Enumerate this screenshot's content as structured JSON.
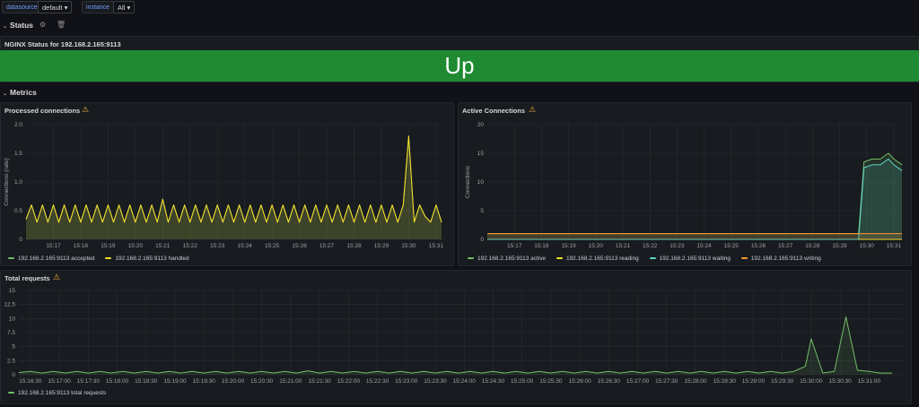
{
  "variables": {
    "datasource": {
      "label": "datasource",
      "value": "default"
    },
    "instance": {
      "label": "instance",
      "value": "All"
    }
  },
  "rows": {
    "status": {
      "title": "Status"
    },
    "metrics": {
      "title": "Metrics"
    }
  },
  "stat_panel": {
    "title": "NGINX Status for 192.168.2.165:9113",
    "value": "Up",
    "color": "#1f8a32"
  },
  "panels": {
    "processed": {
      "title": "Processed connections",
      "ylabel": "Connections (rate)",
      "legend": [
        "192.168.2.165:9113 accepted",
        "192.168.2.165:9113 handled"
      ]
    },
    "active": {
      "title": "Active Connections",
      "ylabel": "Connections",
      "legend": [
        "192.168.2.165:9113 active",
        "192.168.2.165:9113 reading",
        "192.168.2.165:9113 waiting",
        "192.168.2.165:9113 writing"
      ]
    },
    "total": {
      "title": "Total requests",
      "legend": [
        "192.168.2.165:9113 total requests"
      ]
    }
  },
  "colors": {
    "green": "#73bf69",
    "yellow": "#fade2a",
    "blue": "#8ab8ff",
    "orange": "#ff9830",
    "teal": "#5ed6c6",
    "warning": "#f5b73d"
  },
  "chart_data": [
    {
      "type": "line",
      "title": "Processed connections",
      "ylabel": "Connections (rate)",
      "ylim": [
        0,
        2.0
      ],
      "yticks": [
        "0",
        "0.5",
        "1.0",
        "1.5",
        "2.0"
      ],
      "xlim": [
        16.0,
        31.3
      ],
      "xticks": [
        "15:17",
        "15:18",
        "15:19",
        "15:20",
        "15:21",
        "15:22",
        "15:23",
        "15:24",
        "15:25",
        "15:26",
        "15:27",
        "15:28",
        "15:29",
        "15:30",
        "15:31"
      ],
      "xtick_minutes": [
        17,
        18,
        19,
        20,
        21,
        22,
        23,
        24,
        25,
        26,
        27,
        28,
        29,
        30,
        31
      ],
      "series": [
        {
          "name": "192.168.2.165:9113 accepted",
          "color": "#73bf69",
          "x": [
            16.0,
            16.2,
            16.4,
            16.6,
            16.8,
            17.0,
            17.2,
            17.4,
            17.6,
            17.8,
            18.0,
            18.2,
            18.4,
            18.6,
            18.8,
            19.0,
            19.2,
            19.4,
            19.6,
            19.8,
            20.0,
            20.2,
            20.4,
            20.6,
            20.8,
            21.0,
            21.2,
            21.4,
            21.6,
            21.8,
            22.0,
            22.2,
            22.4,
            22.6,
            22.8,
            23.0,
            23.2,
            23.4,
            23.6,
            23.8,
            24.0,
            24.2,
            24.4,
            24.6,
            24.8,
            25.0,
            25.2,
            25.4,
            25.6,
            25.8,
            26.0,
            26.2,
            26.4,
            26.6,
            26.8,
            27.0,
            27.2,
            27.4,
            27.6,
            27.8,
            28.0,
            28.2,
            28.4,
            28.6,
            28.8,
            29.0,
            29.2,
            29.4,
            29.6,
            29.8,
            30.0,
            30.2,
            30.4,
            30.6,
            30.8,
            31.0,
            31.2
          ],
          "y": [
            0.35,
            0.6,
            0.3,
            0.6,
            0.3,
            0.6,
            0.3,
            0.6,
            0.3,
            0.6,
            0.3,
            0.6,
            0.3,
            0.6,
            0.3,
            0.6,
            0.3,
            0.6,
            0.3,
            0.6,
            0.3,
            0.6,
            0.3,
            0.6,
            0.3,
            0.7,
            0.3,
            0.6,
            0.3,
            0.6,
            0.3,
            0.6,
            0.3,
            0.6,
            0.3,
            0.6,
            0.3,
            0.6,
            0.3,
            0.6,
            0.3,
            0.6,
            0.3,
            0.6,
            0.3,
            0.6,
            0.3,
            0.6,
            0.3,
            0.6,
            0.3,
            0.6,
            0.3,
            0.6,
            0.3,
            0.6,
            0.3,
            0.6,
            0.3,
            0.6,
            0.3,
            0.6,
            0.3,
            0.6,
            0.3,
            0.6,
            0.3,
            0.6,
            0.3,
            0.6,
            1.8,
            0.3,
            0.6,
            0.4,
            0.3,
            0.6,
            0.3
          ]
        },
        {
          "name": "192.168.2.165:9113 handled",
          "color": "#fade2a",
          "x": [
            16.0,
            16.2,
            16.4,
            16.6,
            16.8,
            17.0,
            17.2,
            17.4,
            17.6,
            17.8,
            18.0,
            18.2,
            18.4,
            18.6,
            18.8,
            19.0,
            19.2,
            19.4,
            19.6,
            19.8,
            20.0,
            20.2,
            20.4,
            20.6,
            20.8,
            21.0,
            21.2,
            21.4,
            21.6,
            21.8,
            22.0,
            22.2,
            22.4,
            22.6,
            22.8,
            23.0,
            23.2,
            23.4,
            23.6,
            23.8,
            24.0,
            24.2,
            24.4,
            24.6,
            24.8,
            25.0,
            25.2,
            25.4,
            25.6,
            25.8,
            26.0,
            26.2,
            26.4,
            26.6,
            26.8,
            27.0,
            27.2,
            27.4,
            27.6,
            27.8,
            28.0,
            28.2,
            28.4,
            28.6,
            28.8,
            29.0,
            29.2,
            29.4,
            29.6,
            29.8,
            30.0,
            30.2,
            30.4,
            30.6,
            30.8,
            31.0,
            31.2
          ],
          "y": [
            0.35,
            0.6,
            0.3,
            0.6,
            0.3,
            0.6,
            0.3,
            0.6,
            0.3,
            0.6,
            0.3,
            0.6,
            0.3,
            0.6,
            0.3,
            0.6,
            0.3,
            0.6,
            0.3,
            0.6,
            0.3,
            0.6,
            0.3,
            0.6,
            0.3,
            0.7,
            0.3,
            0.6,
            0.3,
            0.6,
            0.3,
            0.6,
            0.3,
            0.6,
            0.3,
            0.6,
            0.3,
            0.6,
            0.3,
            0.6,
            0.3,
            0.6,
            0.3,
            0.6,
            0.3,
            0.6,
            0.3,
            0.6,
            0.3,
            0.6,
            0.3,
            0.6,
            0.3,
            0.6,
            0.3,
            0.6,
            0.3,
            0.6,
            0.3,
            0.6,
            0.3,
            0.6,
            0.3,
            0.6,
            0.3,
            0.6,
            0.3,
            0.6,
            0.3,
            0.6,
            1.8,
            0.3,
            0.6,
            0.4,
            0.3,
            0.6,
            0.3
          ]
        }
      ]
    },
    {
      "type": "line",
      "title": "Active Connections",
      "ylabel": "Connections",
      "ylim": [
        0,
        20
      ],
      "yticks": [
        "0",
        "5",
        "10",
        "15",
        "20"
      ],
      "xlim": [
        16.0,
        31.3
      ],
      "xticks": [
        "15:17",
        "15:18",
        "15:19",
        "15:20",
        "15:21",
        "15:22",
        "15:23",
        "15:24",
        "15:25",
        "15:26",
        "15:27",
        "15:28",
        "15:29",
        "15:30",
        "15:31"
      ],
      "xtick_minutes": [
        17,
        18,
        19,
        20,
        21,
        22,
        23,
        24,
        25,
        26,
        27,
        28,
        29,
        30,
        31
      ],
      "series": [
        {
          "name": "192.168.2.165:9113 active",
          "color": "#73bf69",
          "x": [
            16.0,
            29.5,
            29.7,
            29.9,
            30.2,
            30.5,
            30.8,
            31.0,
            31.3
          ],
          "y": [
            1,
            1,
            1,
            13.5,
            14,
            14,
            15,
            14,
            13
          ]
        },
        {
          "name": "192.168.2.165:9113 reading",
          "color": "#fade2a",
          "x": [
            16.0,
            31.3
          ],
          "y": [
            0,
            0
          ]
        },
        {
          "name": "192.168.2.165:9113 waiting",
          "color": "#5ed6c6",
          "x": [
            16.0,
            29.5,
            29.7,
            29.9,
            30.2,
            30.5,
            30.8,
            31.0,
            31.3
          ],
          "y": [
            0,
            0,
            0,
            12.5,
            13,
            13,
            14,
            13,
            12
          ]
        },
        {
          "name": "192.168.2.165:9113 writing",
          "color": "#ff9830",
          "x": [
            16.0,
            31.3
          ],
          "y": [
            1,
            1
          ]
        }
      ]
    },
    {
      "type": "line",
      "title": "Total requests",
      "ylim": [
        0,
        15
      ],
      "yticks": [
        "0",
        "2.5",
        "5",
        "7.5",
        "10",
        "12.5",
        "15"
      ],
      "xlim": [
        16.3,
        31.6
      ],
      "xticks": [
        "15:16:30",
        "15:17:00",
        "15:17:30",
        "15:18:00",
        "15:18:30",
        "15:19:00",
        "15:19:30",
        "15:20:00",
        "15:20:30",
        "15:21:00",
        "15:21:30",
        "15:22:00",
        "15:22:30",
        "15:23:00",
        "15:23:30",
        "15:24:00",
        "15:24:30",
        "15:25:00",
        "15:25:30",
        "15:26:00",
        "15:26:30",
        "15:27:00",
        "15:27:30",
        "15:28:00",
        "15:28:30",
        "15:29:00",
        "15:29:30",
        "15:30:00",
        "15:30:30",
        "15:31:00"
      ],
      "xtick_minutes": [
        16.5,
        17,
        17.5,
        18,
        18.5,
        19,
        19.5,
        20,
        20.5,
        21,
        21.5,
        22,
        22.5,
        23,
        23.5,
        24,
        24.5,
        25,
        25.5,
        26,
        26.5,
        27,
        27.5,
        28,
        28.5,
        29,
        29.5,
        30,
        30.5,
        31
      ],
      "series": [
        {
          "name": "192.168.2.165:9113 total requests",
          "color": "#73bf69",
          "x": [
            16.3,
            16.5,
            16.7,
            16.9,
            17.1,
            17.3,
            17.5,
            17.7,
            17.9,
            18.1,
            18.3,
            18.5,
            18.7,
            18.9,
            19.1,
            19.3,
            19.5,
            19.7,
            19.9,
            20.1,
            20.3,
            20.5,
            20.7,
            20.9,
            21.1,
            21.3,
            21.5,
            21.7,
            21.9,
            22.1,
            22.3,
            22.5,
            22.7,
            22.9,
            23.1,
            23.3,
            23.5,
            23.7,
            23.9,
            24.1,
            24.3,
            24.5,
            24.7,
            24.9,
            25.1,
            25.3,
            25.5,
            25.7,
            25.9,
            26.1,
            26.3,
            26.5,
            26.7,
            26.9,
            27.1,
            27.3,
            27.5,
            27.7,
            27.9,
            28.1,
            28.3,
            28.5,
            28.7,
            28.9,
            29.1,
            29.3,
            29.5,
            29.7,
            29.9,
            30.0,
            30.2,
            30.4,
            30.6,
            30.8,
            31.0,
            31.2,
            31.4
          ],
          "y": [
            0.4,
            0.6,
            0.3,
            0.6,
            0.3,
            0.6,
            0.3,
            0.6,
            0.3,
            0.6,
            0.3,
            0.6,
            0.3,
            0.6,
            0.3,
            0.6,
            0.3,
            0.6,
            0.3,
            0.6,
            0.3,
            0.6,
            0.3,
            0.6,
            0.3,
            0.7,
            0.3,
            0.6,
            0.3,
            0.6,
            0.3,
            0.6,
            0.3,
            0.6,
            0.3,
            0.6,
            0.3,
            0.6,
            0.3,
            0.6,
            0.3,
            0.6,
            0.3,
            0.6,
            0.3,
            0.6,
            0.3,
            0.6,
            0.3,
            0.6,
            0.3,
            0.6,
            0.3,
            0.6,
            0.3,
            0.6,
            0.3,
            0.6,
            0.3,
            0.6,
            0.3,
            0.6,
            0.3,
            0.6,
            0.3,
            0.6,
            0.3,
            0.6,
            1.5,
            6.4,
            0.3,
            0.6,
            10.3,
            0.8,
            0.6,
            0.3,
            0.3
          ]
        }
      ]
    }
  ]
}
